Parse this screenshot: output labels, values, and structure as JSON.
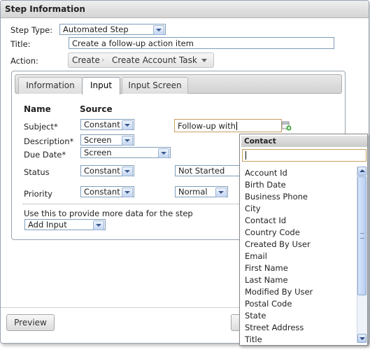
{
  "dialog": {
    "title": "Step Information"
  },
  "form": {
    "step_type_label": "Step Type:",
    "step_type_value": "Automated Step",
    "title_label": "Title:",
    "title_value": "Create a follow-up action item",
    "action_label": "Action:",
    "action_crumb_1": "Create",
    "action_crumb_sep": "›",
    "action_crumb_2": "Create Account Task"
  },
  "tabs": [
    {
      "label": "Information"
    },
    {
      "label": "Input"
    },
    {
      "label": "Input Screen"
    }
  ],
  "active_tab": "Input",
  "input_table": {
    "col_name": "Name",
    "col_source": "Source",
    "rows": [
      {
        "name": "Subject*",
        "source": "Constant",
        "value": "Follow-up with "
      },
      {
        "name": "Description*",
        "source": "Screen"
      },
      {
        "name": "Due Date*",
        "source": "Screen"
      },
      {
        "name": "Status",
        "source": "Constant",
        "value": "Not Started"
      },
      {
        "name": "Priority",
        "source": "Constant",
        "value": "Normal"
      }
    ]
  },
  "more": {
    "hint": "Use this to provide more data for the step",
    "add_input": "Add Input"
  },
  "footer": {
    "preview_label": "Preview"
  },
  "dropdown": {
    "header": "Contact",
    "search_value": "",
    "items": [
      "Account Id",
      "Birth Date",
      "Business Phone",
      "City",
      "Contact Id",
      "Country Code",
      "Created By User",
      "Email",
      "First Name",
      "Last Name",
      "Modified By User",
      "Postal Code",
      "State",
      "Street Address",
      "Title"
    ]
  }
}
